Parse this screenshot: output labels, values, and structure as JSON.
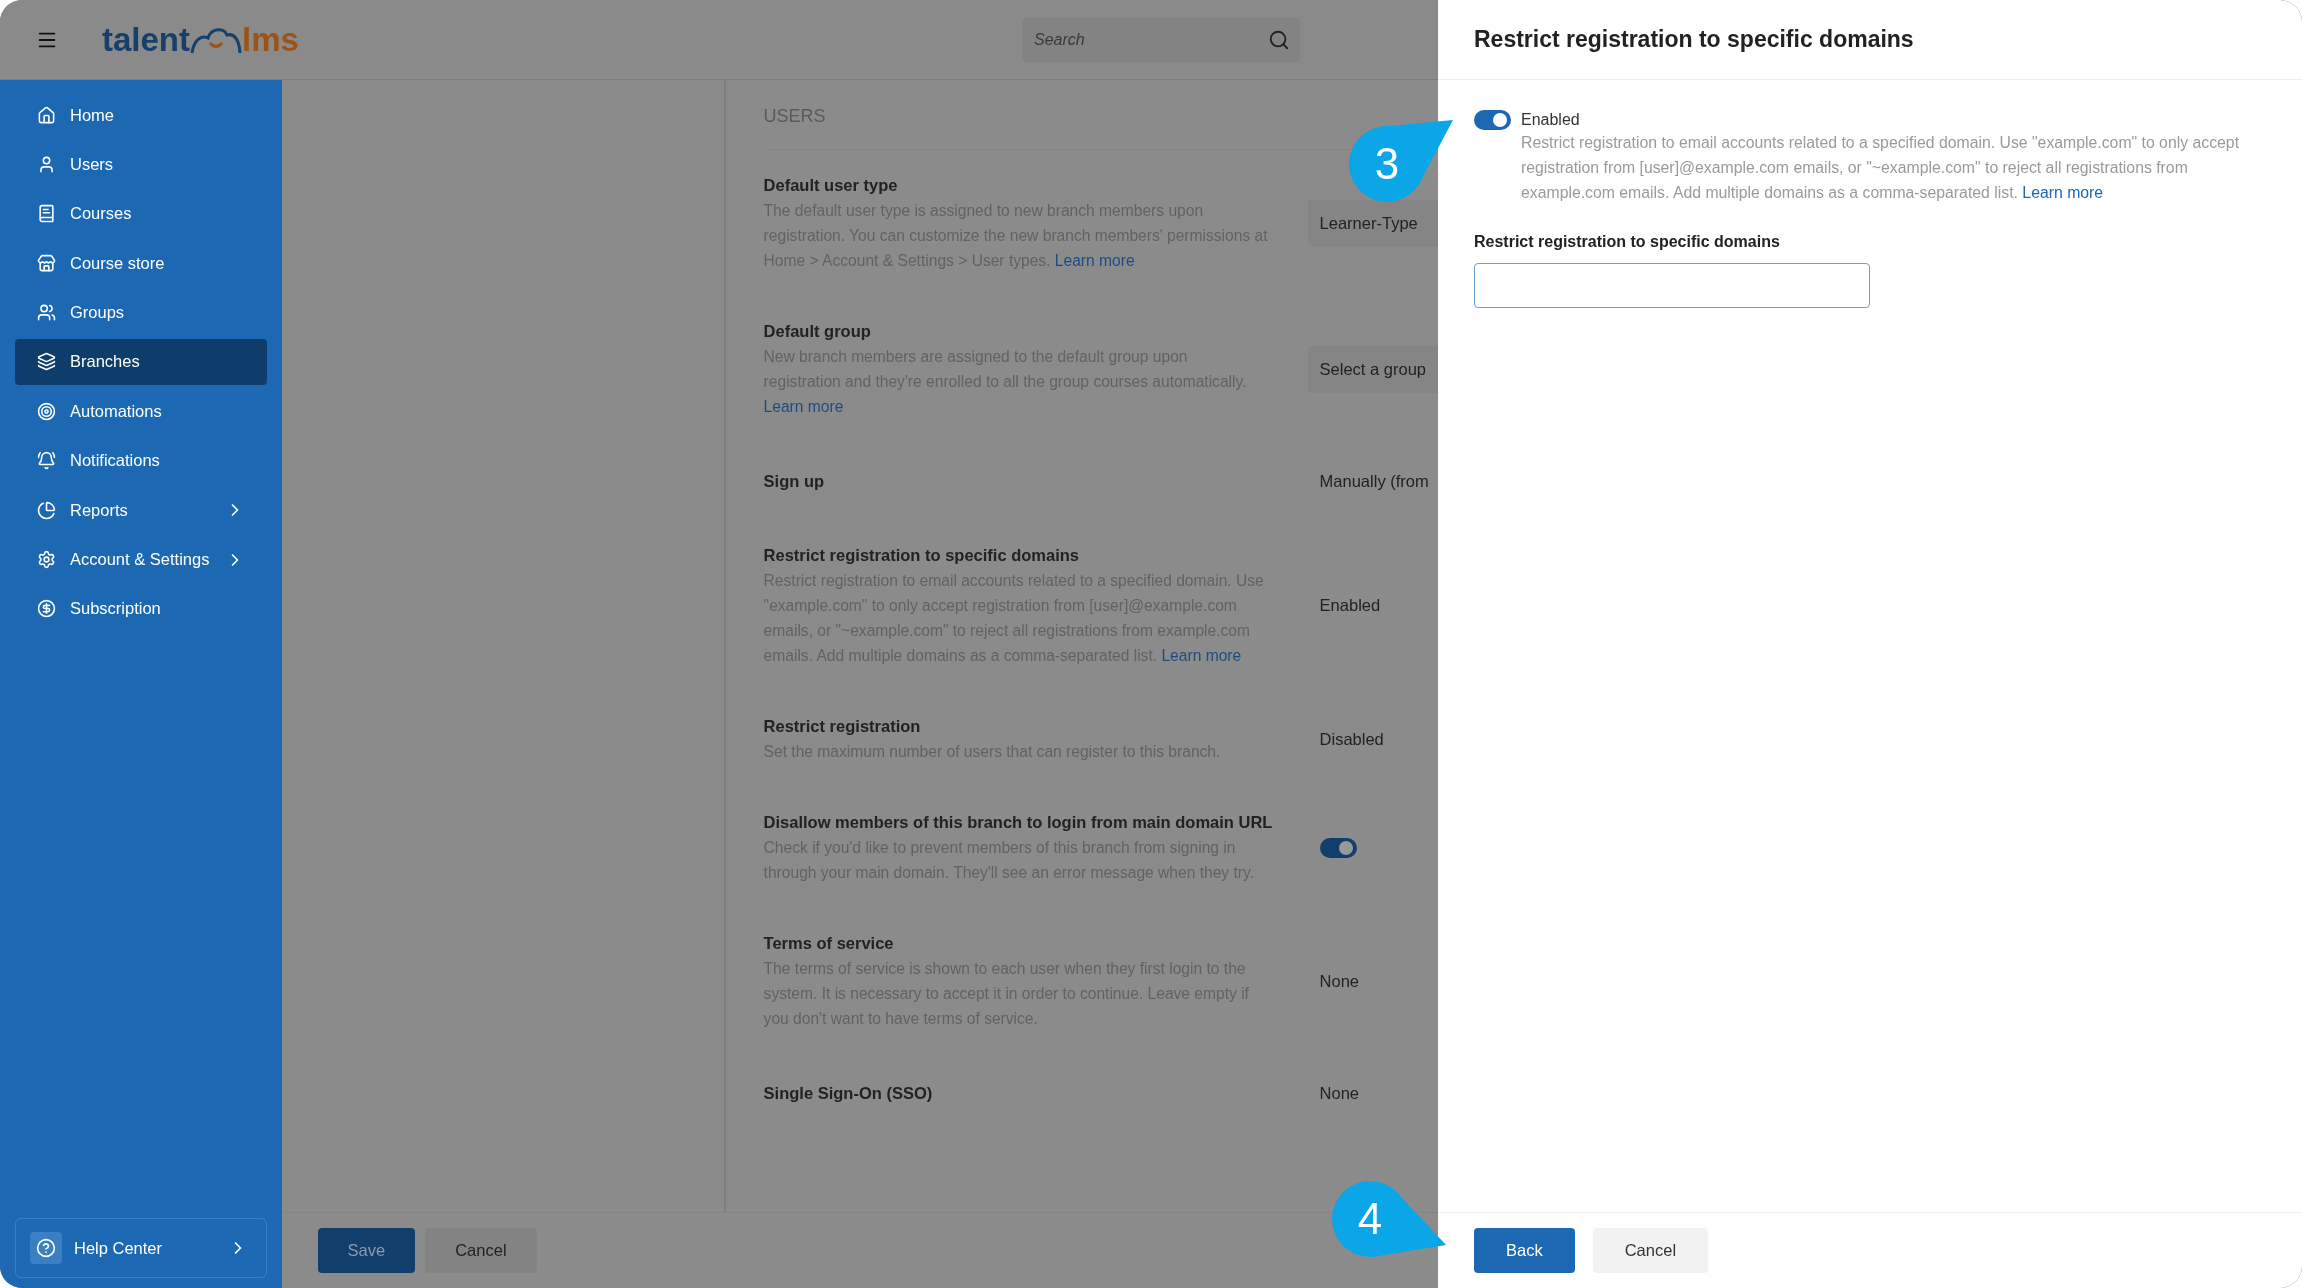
{
  "header": {
    "logo_left": "talent",
    "logo_right": "lms",
    "search": {
      "placeholder": "Search"
    }
  },
  "sidebar": {
    "items": [
      {
        "label": "Home",
        "selected": false,
        "expandable": false
      },
      {
        "label": "Users",
        "selected": false,
        "expandable": false
      },
      {
        "label": "Courses",
        "selected": false,
        "expandable": false
      },
      {
        "label": "Course store",
        "selected": false,
        "expandable": false
      },
      {
        "label": "Groups",
        "selected": false,
        "expandable": false
      },
      {
        "label": "Branches",
        "selected": true,
        "expandable": false
      },
      {
        "label": "Automations",
        "selected": false,
        "expandable": false
      },
      {
        "label": "Notifications",
        "selected": false,
        "expandable": false
      },
      {
        "label": "Reports",
        "selected": false,
        "expandable": true
      },
      {
        "label": "Account & Settings",
        "selected": false,
        "expandable": true
      },
      {
        "label": "Subscription",
        "selected": false,
        "expandable": false
      }
    ],
    "help": {
      "label": "Help Center"
    }
  },
  "section": {
    "title": "USERS",
    "settings": [
      {
        "kind": "select",
        "title": "Default user type",
        "description": "The default user type is assigned to new branch members upon registration. You can customize the new branch members' permissions at Home > Account & Settings > User types.",
        "link": "Learn more",
        "value": "Learner-Type"
      },
      {
        "kind": "select",
        "title": "Default group",
        "description": "New branch members are assigned to the default group upon registration and they're enrolled to all the group courses automatically.",
        "link": "Learn more",
        "value": "Select a group"
      },
      {
        "kind": "text",
        "title": "Sign up",
        "value": "Manually (from"
      },
      {
        "kind": "text",
        "title": "Restrict registration to specific domains",
        "description": "Restrict registration to email accounts related to a specified domain. Use \"example.com\" to only accept registration from [user]@example.com emails, or \"~example.com\" to reject all registrations from example.com emails. Add multiple domains as a comma-separated list.",
        "link": "Learn more",
        "value": "Enabled"
      },
      {
        "kind": "text",
        "title": "Restrict registration",
        "description": "Set the maximum number of users that can register to this branch.",
        "value": "Disabled"
      },
      {
        "kind": "toggle",
        "title": "Disallow members of this branch to login from main domain URL",
        "description": "Check if you'd like to prevent members of this branch from signing in through your main domain. They'll see an error message when they try.",
        "on": true
      },
      {
        "kind": "text",
        "title": "Terms of service",
        "description": "The terms of service is shown to each user when they first login to the system. It is necessary to accept it in order to continue. Leave empty if you don't want to have terms of service.",
        "value": "None"
      },
      {
        "kind": "text",
        "title": "Single Sign-On (SSO)",
        "value": "None"
      }
    ]
  },
  "footer": {
    "buttons": [
      "Save",
      "Cancel"
    ]
  },
  "drawer": {
    "title": "Restrict registration to specific domains",
    "toggle": {
      "on": true,
      "label": "Enabled"
    },
    "description": "Restrict registration to email accounts related to a specified domain. Use \"example.com\" to only accept registration from [user]@example.com emails, or \"~example.com\" to reject all registrations from example.com emails. Add multiple domains as a comma-separated list.",
    "link": "Learn more",
    "field": {
      "label": "Restrict registration to specific domains"
    },
    "buttons": [
      "Back",
      "Cancel"
    ]
  },
  "callouts": [
    "3",
    "4"
  ]
}
